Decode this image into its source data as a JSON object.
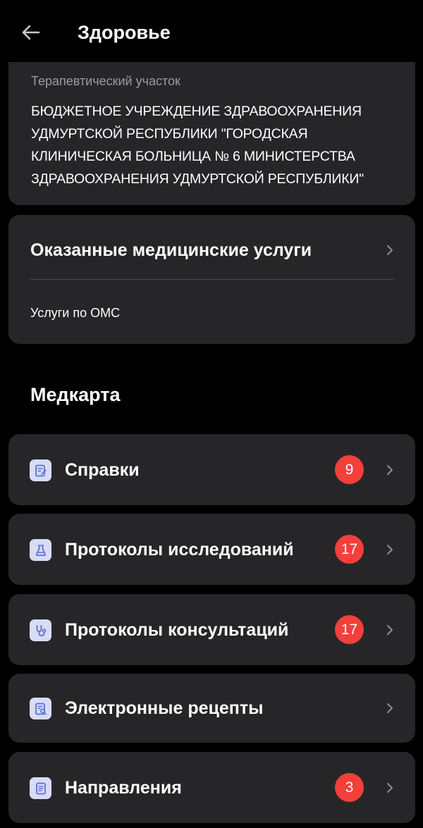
{
  "header": {
    "title": "Здоровье",
    "back_icon": "arrow-left-icon"
  },
  "district": {
    "label": "Терапевтический участок",
    "value": "БЮДЖЕТНОЕ УЧРЕЖДЕНИЕ ЗДРАВООХРАНЕНИЯ УДМУРТСКОЙ РЕСПУБЛИКИ \"ГОРОДСКАЯ КЛИНИЧЕСКАЯ БОЛЬНИЦА № 6 МИНИСТЕРСТВА ЗДРАВООХРАНЕНИЯ УДМУРТСКОЙ РЕСПУБЛИКИ\""
  },
  "services": {
    "title": "Оказанные медицинские услуги",
    "subtitle": "Услуги по ОМС"
  },
  "medcard": {
    "title": "Медкарта",
    "items": [
      {
        "label": "Справки",
        "badge": "9",
        "icon": "certificate-icon"
      },
      {
        "label": "Протоколы исследований",
        "badge": "17",
        "icon": "flask-icon"
      },
      {
        "label": "Протоколы консультаций",
        "badge": "17",
        "icon": "stethoscope-icon"
      },
      {
        "label": "Электронные рецепты",
        "badge": "",
        "icon": "prescription-icon"
      },
      {
        "label": "Направления",
        "badge": "3",
        "icon": "document-icon"
      }
    ]
  },
  "colors": {
    "background": "#000000",
    "card": "#262629",
    "badge": "#f43f3a",
    "icon_bg": "#d8dcf4",
    "icon_fg": "#5b6fd6",
    "muted_text": "#9a9aa0"
  }
}
